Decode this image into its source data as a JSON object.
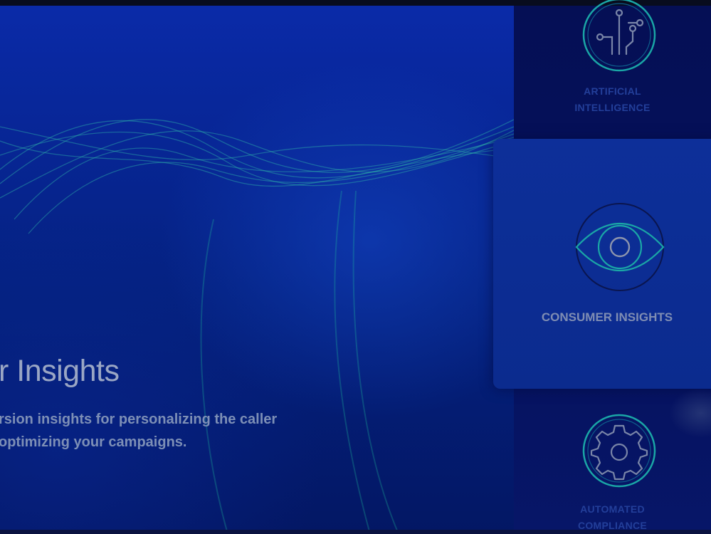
{
  "hero": {
    "title": "r Insights",
    "description_line1": "rsion insights for personalizing the caller",
    "description_line2": "optimizing your campaigns."
  },
  "solutions": [
    {
      "label_line1": "ARTIFICIAL",
      "label_line2": "INTELLIGENCE",
      "icon": "circuit-icon",
      "active": false
    },
    {
      "label": "CONSUMER INSIGHTS",
      "icon": "eye-icon",
      "active": true
    },
    {
      "label_line1": "AUTOMATED",
      "label_line2": "COMPLIANCE",
      "icon": "gear-icon",
      "active": false
    }
  ],
  "colors": {
    "background": "#031a6b",
    "active_card": "#0c2d94",
    "icon_teal": "#1aa6a6",
    "label_inactive": "#233f9a",
    "label_active": "#7f8db3"
  }
}
